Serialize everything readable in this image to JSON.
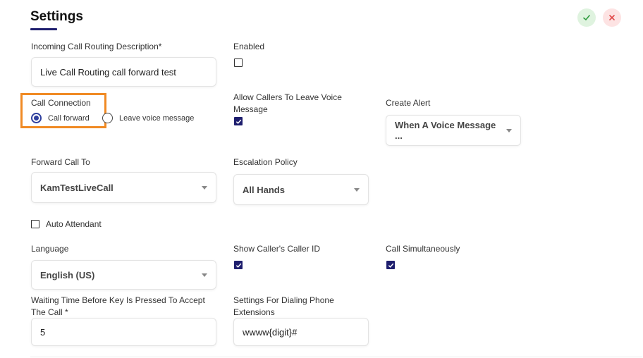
{
  "page": {
    "title": "Settings"
  },
  "actions": {
    "confirm_icon": "check-icon",
    "close_icon": "close-icon",
    "confirm_color": "#2e9b3e",
    "close_color": "#e04848"
  },
  "fields": {
    "description": {
      "label": "Incoming Call Routing Description*",
      "value": "Live Call Routing call forward test"
    },
    "enabled": {
      "label": "Enabled",
      "checked": false
    },
    "call_connection": {
      "label": "Call Connection",
      "options": [
        {
          "label": "Call forward",
          "selected": true
        },
        {
          "label": "Leave voice message",
          "selected": false
        }
      ]
    },
    "allow_voice_message": {
      "label_line1": "Allow Callers To Leave Voice",
      "label_line2": "Message",
      "checked": true
    },
    "create_alert": {
      "label": "Create Alert",
      "value": "When A Voice Message ..."
    },
    "forward_call_to": {
      "label": "Forward Call To",
      "value": "KamTestLiveCall"
    },
    "escalation_policy": {
      "label": "Escalation Policy",
      "value": "All Hands"
    },
    "auto_attendant": {
      "label": "Auto Attendant",
      "checked": false
    },
    "language": {
      "label": "Language",
      "value": "English (US)"
    },
    "show_caller_id": {
      "label": "Show Caller's Caller ID",
      "checked": true
    },
    "call_simultaneously": {
      "label": "Call Simultaneously",
      "checked": true
    },
    "waiting_time": {
      "label_line1": "Waiting Time Before Key Is Pressed To Accept",
      "label_line2": "The Call *",
      "value": "5"
    },
    "dialing_extensions": {
      "label_line1": "Settings For Dialing Phone",
      "label_line2": "Extensions",
      "value": "wwww{digit}#"
    }
  },
  "colors": {
    "accent": "#1e1e6e",
    "radio_accent": "#2e3f9e",
    "highlight": "#f08a24"
  }
}
